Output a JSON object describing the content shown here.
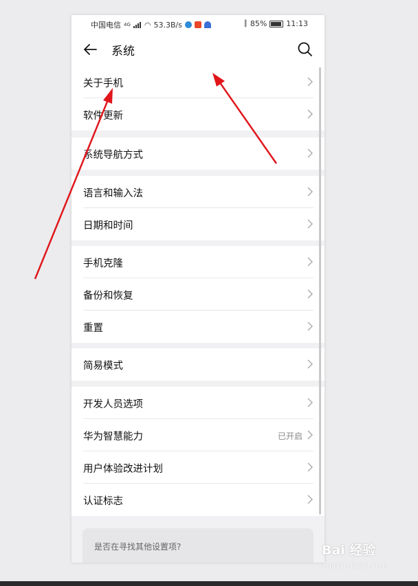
{
  "status_bar": {
    "carrier": "中国电信",
    "network": "4G",
    "speed": "53.3B/s",
    "battery": "85%",
    "time": "11:13"
  },
  "header": {
    "title": "系统",
    "back_icon": "arrow-left-icon",
    "search_icon": "search-icon"
  },
  "groups": [
    {
      "items": [
        {
          "label": "关于手机"
        },
        {
          "label": "软件更新"
        }
      ]
    },
    {
      "items": [
        {
          "label": "系统导航方式"
        }
      ]
    },
    {
      "items": [
        {
          "label": "语言和输入法"
        },
        {
          "label": "日期和时间"
        }
      ]
    },
    {
      "items": [
        {
          "label": "手机克隆"
        },
        {
          "label": "备份和恢复"
        },
        {
          "label": "重置"
        }
      ]
    },
    {
      "items": [
        {
          "label": "简易模式"
        }
      ]
    },
    {
      "items": [
        {
          "label": "开发人员选项"
        },
        {
          "label": "华为智慧能力",
          "value": "已开启"
        },
        {
          "label": "用户体验改进计划"
        },
        {
          "label": "认证标志"
        }
      ]
    }
  ],
  "suggestion": {
    "text": "是否在寻找其他设置项?"
  },
  "watermark": {
    "main": "Bai 经验",
    "sub": "jingyan.baidu.com"
  },
  "colors": {
    "annotation_arrow": "#e0161b",
    "background": "#f1f1f3",
    "card": "#ffffff"
  }
}
